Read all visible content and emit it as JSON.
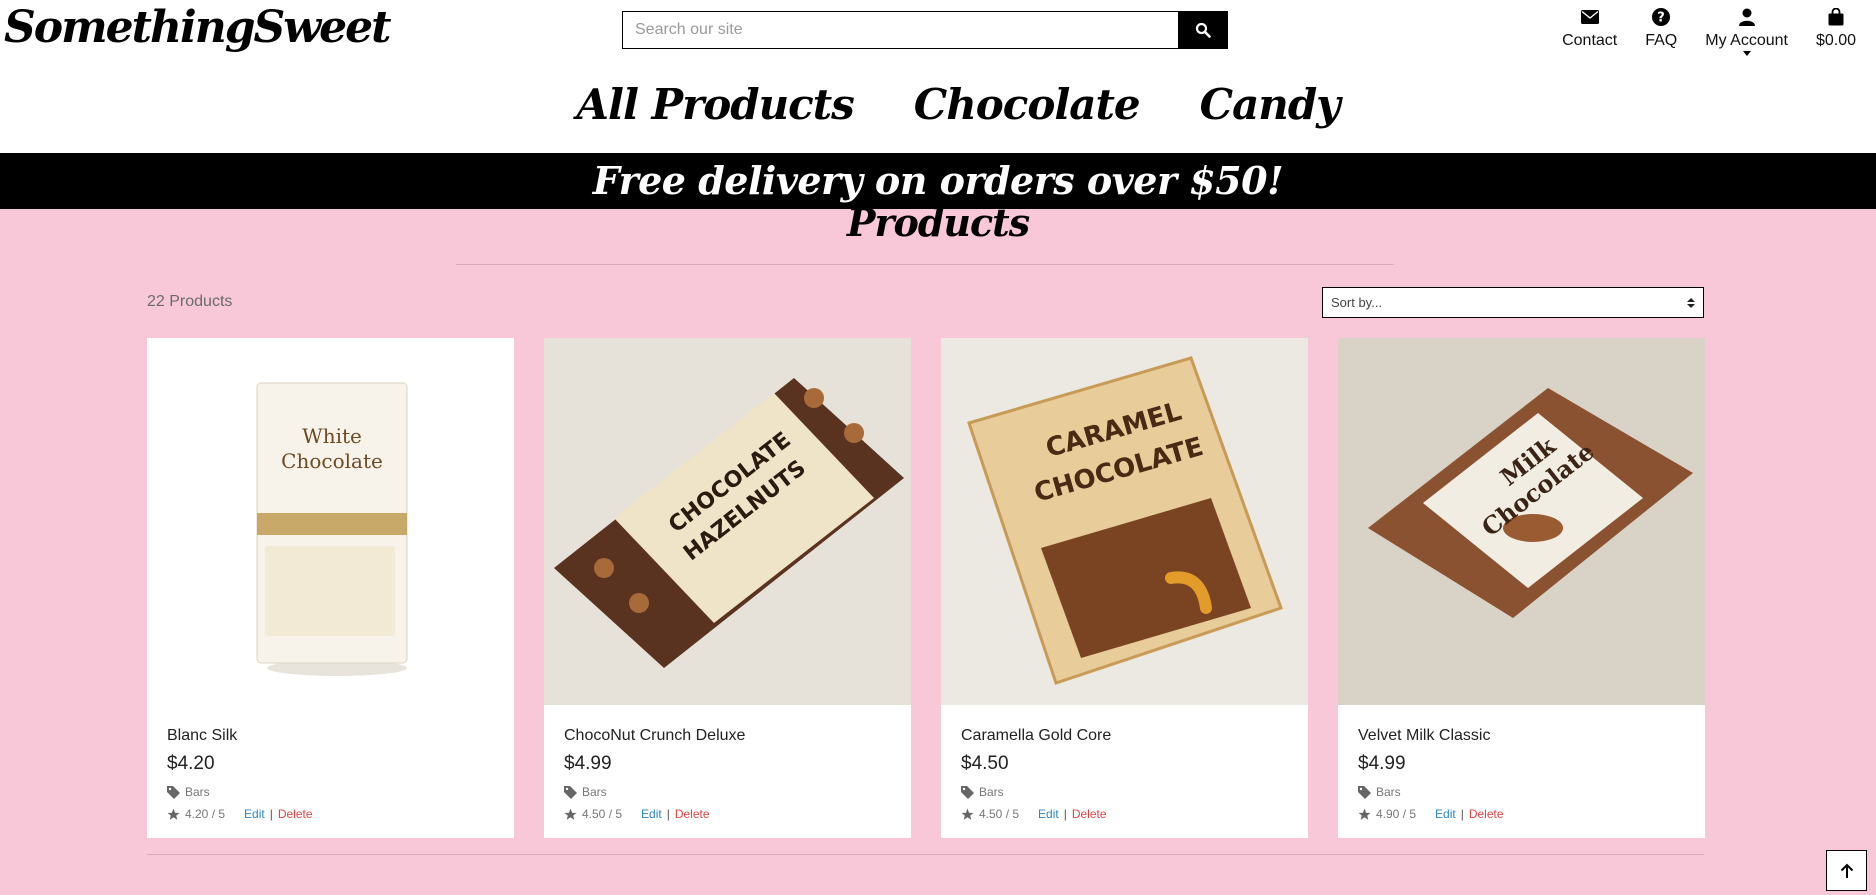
{
  "header": {
    "logo": "SomethingSweet",
    "search": {
      "placeholder": "Search our site",
      "value": ""
    },
    "links": [
      {
        "label": "Contact",
        "icon": "envelope-icon"
      },
      {
        "label": "FAQ",
        "icon": "question-circle-icon"
      },
      {
        "label": "My Account",
        "icon": "user-icon"
      },
      {
        "label": "$0.00",
        "icon": "shopping-bag-icon"
      }
    ]
  },
  "nav": {
    "items": [
      "All Products",
      "Chocolate",
      "Candy"
    ]
  },
  "banner": {
    "text": "Free delivery on orders over $50!"
  },
  "main": {
    "title": "Products",
    "count": "22 Products",
    "sort_label": "Sort by..."
  },
  "products": [
    {
      "name": "Blanc Silk",
      "price": "$4.20",
      "category": "Bars",
      "rating": "4.20 / 5",
      "edit": "Edit",
      "sep": "|",
      "delete": "Delete",
      "image": {
        "bg": "#ffffff",
        "wrapper": "#f7f3ea",
        "text_lines": [
          "White",
          "Chocolate"
        ],
        "text_color": "#6b4a24"
      }
    },
    {
      "name": "ChocoNut Crunch Deluxe",
      "price": "$4.99",
      "category": "Bars",
      "rating": "4.50 / 5",
      "edit": "Edit",
      "sep": "|",
      "delete": "Delete",
      "image": {
        "bg": "#e6e2d9",
        "wrapper": "#efe3c8",
        "text_lines": [
          "CHOCOLATE",
          "HAZELNUTS"
        ],
        "text_color": "#2a1a10"
      }
    },
    {
      "name": "Caramella Gold Core",
      "price": "$4.50",
      "category": "Bars",
      "rating": "4.50 / 5",
      "edit": "Edit",
      "sep": "|",
      "delete": "Delete",
      "image": {
        "bg": "#ece9e2",
        "wrapper": "#e8cc9a",
        "text_lines": [
          "CARAMEL",
          "CHOCOLATE"
        ],
        "text_color": "#4b2a14"
      }
    },
    {
      "name": "Velvet Milk Classic",
      "price": "$4.99",
      "category": "Bars",
      "rating": "4.90 / 5",
      "edit": "Edit",
      "sep": "|",
      "delete": "Delete",
      "image": {
        "bg": "#d9d2c7",
        "wrapper": "#f2ede2",
        "text_lines": [
          "Milk",
          "Chocolate"
        ],
        "text_color": "#3a2416"
      }
    }
  ],
  "colors": {
    "page_bg": "#f9c8d8",
    "banner_bg": "#000000",
    "edit": "#2c86c9",
    "delete": "#e04646"
  }
}
